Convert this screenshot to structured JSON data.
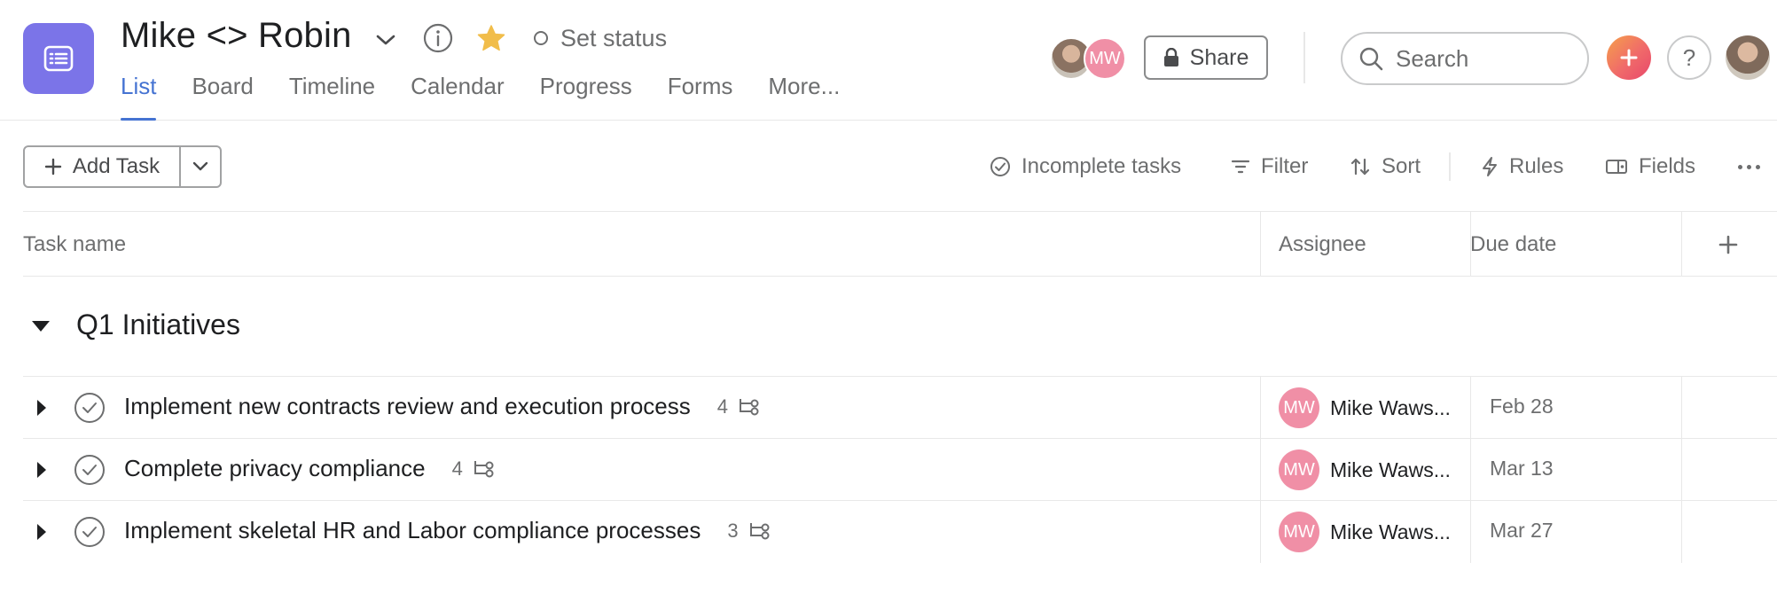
{
  "header": {
    "project_title": "Mike <> Robin",
    "set_status": "Set status",
    "tabs": [
      {
        "label": "List",
        "active": true
      },
      {
        "label": "Board",
        "active": false
      },
      {
        "label": "Timeline",
        "active": false
      },
      {
        "label": "Calendar",
        "active": false
      },
      {
        "label": "Progress",
        "active": false
      },
      {
        "label": "Forms",
        "active": false
      },
      {
        "label": "More...",
        "active": false
      }
    ],
    "member_initials": "MW",
    "share_label": "Share",
    "search_placeholder": "Search",
    "help_label": "?"
  },
  "toolbar": {
    "add_task_label": "Add Task",
    "incomplete_label": "Incomplete tasks",
    "filter_label": "Filter",
    "sort_label": "Sort",
    "rules_label": "Rules",
    "fields_label": "Fields"
  },
  "columns": {
    "task_name": "Task name",
    "assignee": "Assignee",
    "due_date": "Due date"
  },
  "section": {
    "title": "Q1 Initiatives"
  },
  "tasks": [
    {
      "name": "Implement new contracts review and execution process",
      "subtasks": "4",
      "assignee_initials": "MW",
      "assignee": "Mike Waws...",
      "due": "Feb 28"
    },
    {
      "name": "Complete privacy compliance",
      "subtasks": "4",
      "assignee_initials": "MW",
      "assignee": "Mike Waws...",
      "due": "Mar 13"
    },
    {
      "name": "Implement skeletal HR and Labor compliance processes",
      "subtasks": "3",
      "assignee_initials": "MW",
      "assignee": "Mike Waws...",
      "due": "Mar 27"
    }
  ],
  "colors": {
    "accent": "#4573d2",
    "project_icon": "#7b74e8",
    "star": "#f1bd4a",
    "avatar_mw": "#f08fa6"
  },
  "icons": [
    "list-icon",
    "chevron-down-icon",
    "info-icon",
    "star-icon",
    "lock-icon",
    "search-icon",
    "plus-icon",
    "help-icon",
    "check-circle-icon",
    "filter-icon",
    "sort-icon",
    "lightning-icon",
    "fields-icon",
    "more-icon",
    "caret-right-icon",
    "caret-down-icon",
    "subtask-icon"
  ]
}
